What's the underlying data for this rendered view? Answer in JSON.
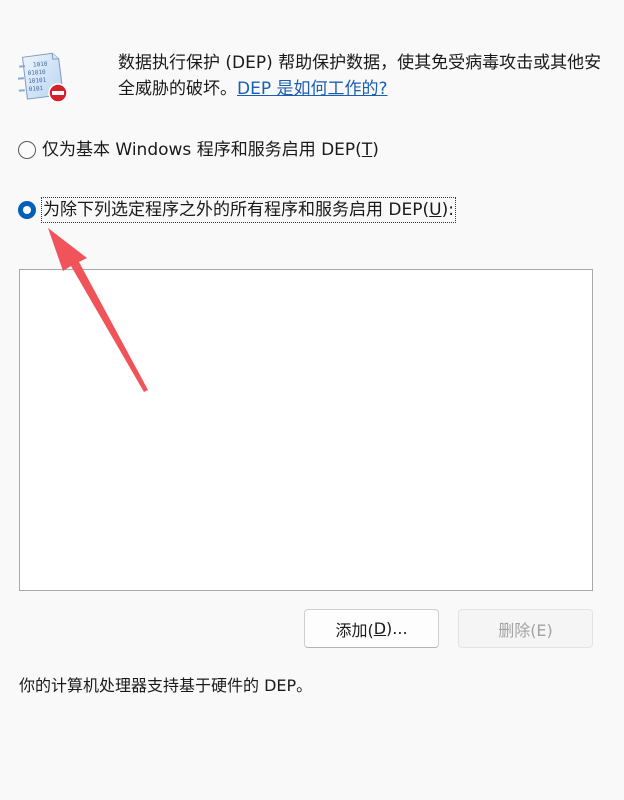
{
  "description": {
    "text": "数据执行保护 (DEP) 帮助保护数据，使其免受病毒攻击或其他安全威胁的破坏。",
    "help_link": "DEP 是如何工作的?"
  },
  "options": {
    "basic": {
      "label_prefix": "仅为基本 Windows 程序和服务启用 DEP(",
      "accesskey": "T",
      "label_suffix": ")",
      "selected": false
    },
    "all_except": {
      "label_prefix": "为除下列选定程序之外的所有程序和服务启用 DEP(",
      "accesskey": "U",
      "label_suffix": "):",
      "selected": true
    }
  },
  "program_list": {
    "items": []
  },
  "buttons": {
    "add": {
      "label_prefix": "添加(",
      "accesskey": "D",
      "label_suffix": ")...",
      "enabled": true
    },
    "remove": {
      "label": "删除(E)",
      "enabled": false
    }
  },
  "status": {
    "hardware": "你的计算机处理器支持基于硬件的 DEP。"
  },
  "colors": {
    "accent": "#005fb8",
    "link": "#1a5fb4",
    "annotation_arrow": "#f0545a"
  },
  "icons": {
    "dep": "dep-shield-binary-icon"
  }
}
